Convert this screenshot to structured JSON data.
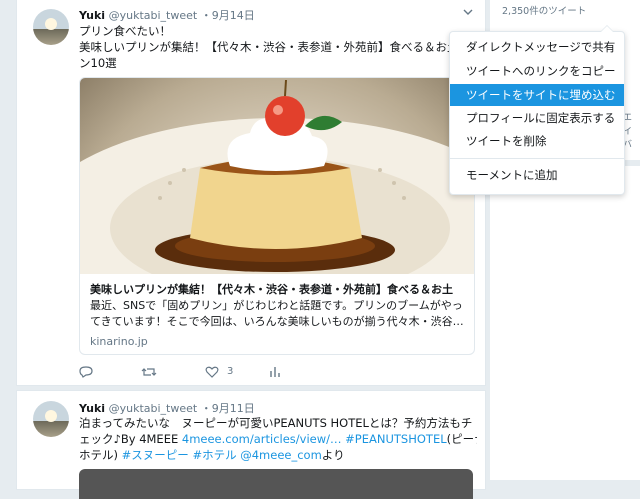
{
  "tweet1": {
    "name": "Yuki",
    "handle": "@yuktabi_tweet",
    "date": "・9月14日",
    "line1": "プリン食べたい！",
    "line2": "美味しいプリンが集結！【代々木・渋谷・表参道・外苑前】食べる＆お土産",
    "line3": "ン10選",
    "card": {
      "title": "美味しいプリンが集結！【代々木・渋谷・表参道・外苑前】食べる＆お土",
      "desc1": "最近、SNSで「固めプリン」がじわじわと話題です。プリンのブームがやっ",
      "desc2": "てきています！そこで今回は、いろんな美味しいものが揃う代々木・渋谷…",
      "domain": "kinarino.jp"
    },
    "like_count": "3"
  },
  "tweet2": {
    "name": "Yuki",
    "handle": "@yuktabi_tweet",
    "date": "・9月11日",
    "line1": "泊まってみたいな　ヌーピーが可愛いPEANUTS HOTELとは？予約方法もチ",
    "line2_a": "ェック♪By 4MEEE ",
    "line2_link": "4meee.com/articles/view/… #PEANUTSHOTEL",
    "line2_b": "(ピーナッツ",
    "line3_a": "ホテル) ",
    "line3_link": "#スヌーピー #ホテル @4meee_com",
    "line3_b": "より"
  },
  "menu": {
    "items": [
      "ダイレクトメッセージで共有",
      "ツイートへのリンクをコピー",
      "ツイートをサイトに埋め込む",
      "プロフィールに固定表示する",
      "ツイートを削除"
    ],
    "extra": "モーメントに追加",
    "active_index": 2
  },
  "sidebar": {
    "tweet_count": "2,350件のツイート",
    "peek1": "エ",
    "peek2": "イバ"
  },
  "colors": {
    "accent": "#1b95e0",
    "like": "#657786"
  }
}
